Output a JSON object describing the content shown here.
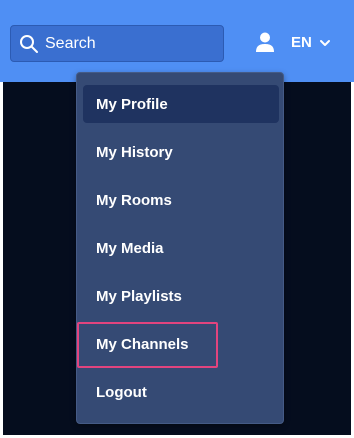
{
  "header": {
    "search_placeholder": "Search",
    "language": "EN",
    "icons": {
      "search": "search-icon",
      "user": "user-icon",
      "chevron": "chevron-down-icon"
    }
  },
  "menu": {
    "items": [
      {
        "label": "My Profile",
        "active": true
      },
      {
        "label": "My History",
        "active": false
      },
      {
        "label": "My Rooms",
        "active": false
      },
      {
        "label": "My Media",
        "active": false
      },
      {
        "label": "My Playlists",
        "active": false
      },
      {
        "label": "My Channels",
        "active": false,
        "highlighted": true
      },
      {
        "label": "Logout",
        "active": false
      }
    ]
  },
  "colors": {
    "header_bg": "#4f8ff4",
    "search_bg": "#3a6fd0",
    "page_bg": "#050d1e",
    "menu_bg": "#354a74",
    "menu_active_bg": "#1f3360",
    "highlight": "#e2447e"
  }
}
